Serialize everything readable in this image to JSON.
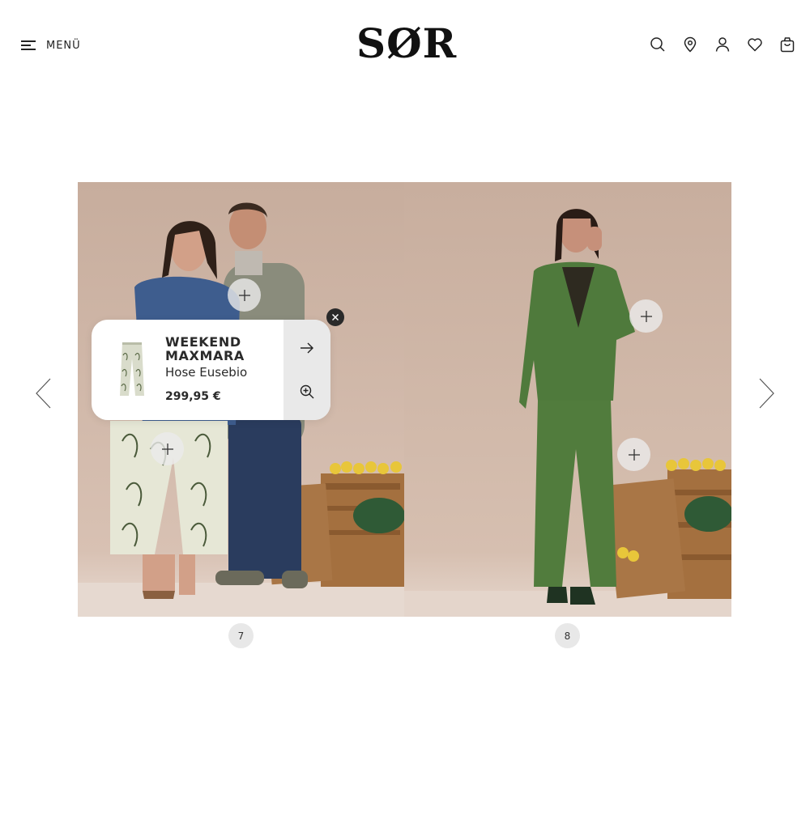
{
  "header": {
    "menu_label": "MENÜ",
    "logo_text": "SØR",
    "icons": [
      "search-icon",
      "location-pin-icon",
      "user-icon",
      "heart-icon",
      "shopping-bag-icon"
    ]
  },
  "gallery": {
    "pages": [
      {
        "number": "7"
      },
      {
        "number": "8"
      }
    ]
  },
  "popup": {
    "brand": "WEEKEND MAXMARA",
    "product_name": "Hose Eusebio",
    "price": "299,95 €"
  },
  "colors": {
    "background": "#ffffff",
    "text": "#222222",
    "hotspot": "#ebebeb",
    "popup_actions": "#e9e9e9",
    "close_button": "#2a2a2a"
  }
}
